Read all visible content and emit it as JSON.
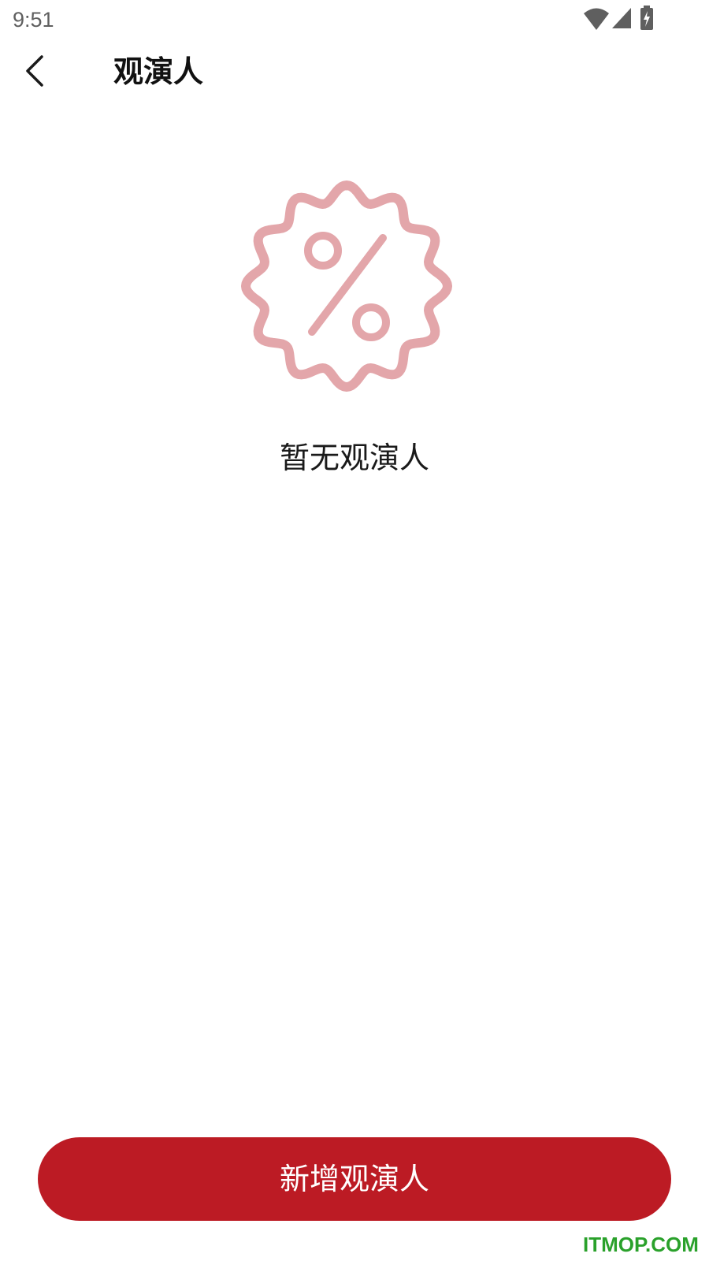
{
  "status_bar": {
    "time": "9:51",
    "icons": [
      "wifi-icon",
      "cellular-signal-icon",
      "battery-charging-icon"
    ]
  },
  "header": {
    "back_icon": "chevron-left-icon",
    "title": "观演人"
  },
  "empty_state": {
    "icon": "discount-badge-icon",
    "message": "暂无观演人"
  },
  "actions": {
    "add_label": "新增观演人"
  },
  "watermark": "ITMOP.COM",
  "colors": {
    "primary": "#bc1b24",
    "illustration": "#e3a6aa",
    "watermark": "#2aa12b"
  }
}
